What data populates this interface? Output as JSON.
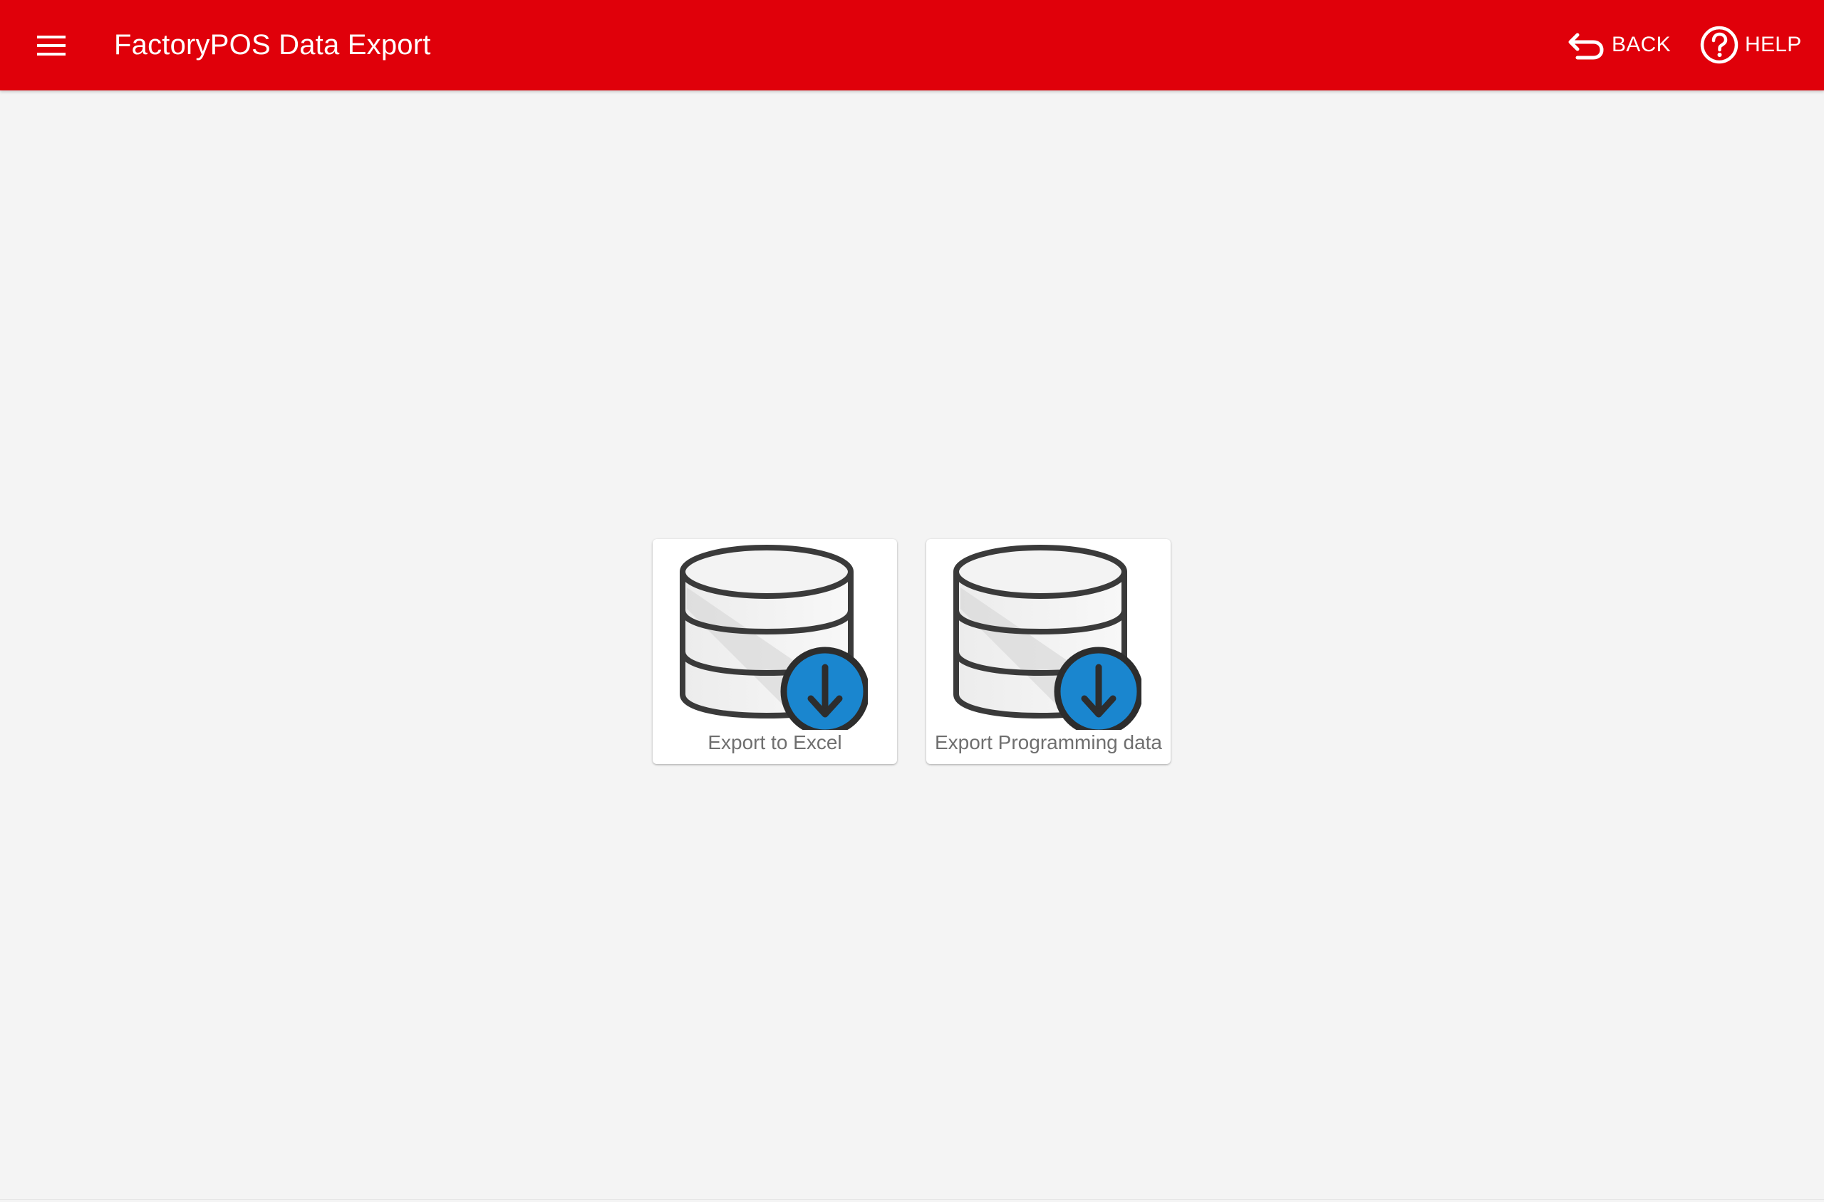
{
  "header": {
    "title": "FactoryPOS Data Export",
    "back_label": "BACK",
    "help_label": "HELP",
    "icons": {
      "menu": "hamburger-menu-icon",
      "back": "undo-arrow-icon",
      "help": "question-circle-icon"
    }
  },
  "cards": [
    {
      "label": "Export to Excel",
      "icon": "database-download-icon"
    },
    {
      "label": "Export Programming data",
      "icon": "database-download-icon"
    }
  ],
  "colors": {
    "appbar": "#e0000a",
    "background": "#f4f4f4",
    "card_label": "#6f6f6f",
    "download_badge": "#1a86cf",
    "icon_outline": "#3a3a3a"
  }
}
